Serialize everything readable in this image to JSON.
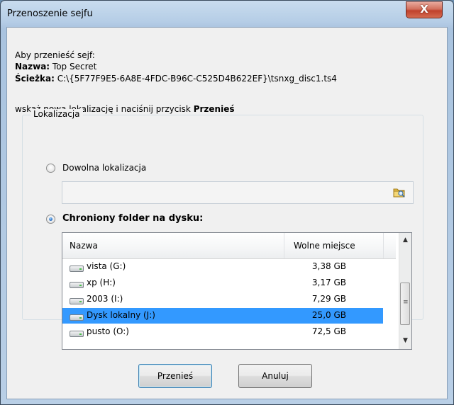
{
  "window": {
    "title": "Przenoszenie sejfu",
    "close_label": "X"
  },
  "info": {
    "intro": "Aby przenieść sejf:",
    "name_label": "Nazwa:",
    "name_value": " Top Secret",
    "path_label": "Ścieżka:",
    "path_value": " C:\\{5F77F9E5-6A8E-4FDC-B96C-C525D4B622EF}\\tsnxg_disc1.ts4",
    "instruction_prefix": "wskaż nową lokalizację i naciśnij przycisk ",
    "instruction_bold": "Przenieś"
  },
  "location_group": {
    "label": "Lokalizacja",
    "option_any": "Dowolna lokalizacja",
    "option_any_selected": false,
    "path_value": "",
    "option_protected": "Chroniony folder na dysku:",
    "option_protected_selected": true
  },
  "drive_list": {
    "columns": [
      "Nazwa",
      "Wolne miejsce"
    ],
    "rows": [
      {
        "name": "vista (G:)",
        "free": "3,38 GB",
        "selected": false
      },
      {
        "name": "xp (H:)",
        "free": "3,17 GB",
        "selected": false
      },
      {
        "name": "2003 (I:)",
        "free": "7,29 GB",
        "selected": false
      },
      {
        "name": "Dysk lokalny (J:)",
        "free": "25,0 GB",
        "selected": true
      },
      {
        "name": "pusto (O:)",
        "free": "72,5 GB",
        "selected": false
      }
    ],
    "scroll_up": "▲",
    "scroll_down": "▼",
    "scroll_grip": "≡"
  },
  "buttons": {
    "move": "Przenieś",
    "cancel": "Anuluj"
  },
  "colors": {
    "selection": "#3399ff",
    "window_frame": "#b5cde6"
  }
}
